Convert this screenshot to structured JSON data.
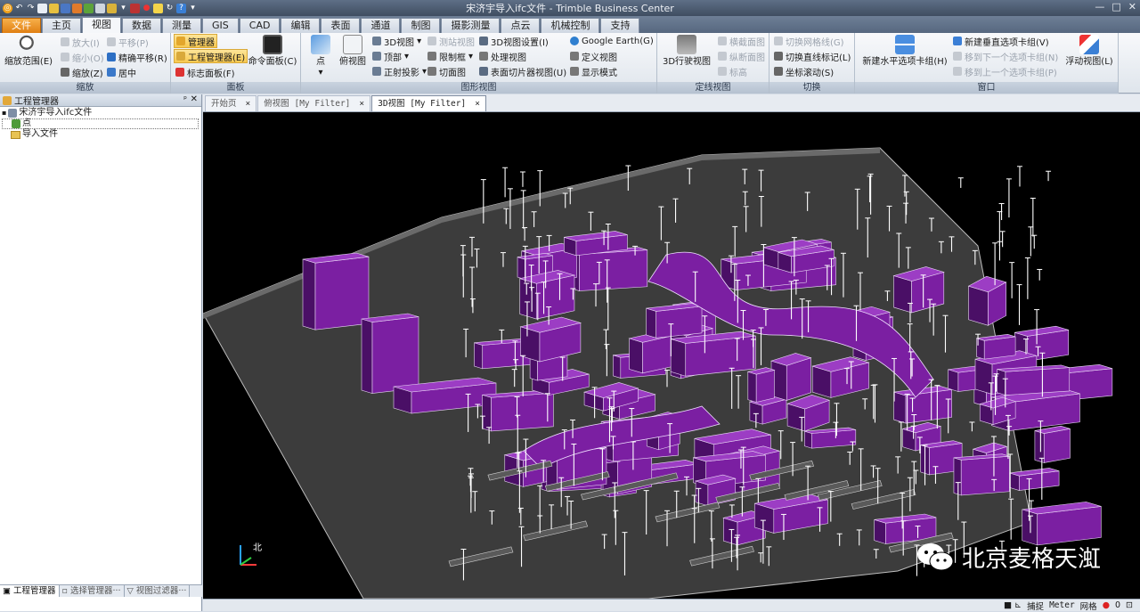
{
  "window": {
    "title": "宋济宇导入ifc文件 - Trimble Business Center"
  },
  "tabs": [
    "文件",
    "主页",
    "视图",
    "数据",
    "测量",
    "GIS",
    "CAD",
    "编辑",
    "表面",
    "通道",
    "制图",
    "摄影测量",
    "点云",
    "机械控制",
    "支持"
  ],
  "active_tab": "视图",
  "ribbon": {
    "zoom": {
      "label": "缩放",
      "zoom_extents": "缩放范围(E)",
      "zoom_in": "放大(I)",
      "zoom_out": "缩小(O)",
      "zoom": "缩放(Z)",
      "pan": "平移(P)",
      "precise_pan": "精确平移(R)",
      "center": "居中"
    },
    "panels": {
      "label": "面板",
      "manager": "管理器",
      "project_manager": "工程管理器(E)",
      "flag_panel": "标志面板(F)",
      "command_panel": "命令面板(C)"
    },
    "graphic": {
      "label": "图形视图",
      "point": "点",
      "plan_view": "俯视图",
      "view3d": "3D视图",
      "top": "顶部",
      "ortho": "正射投影",
      "survey_view": "测站视图",
      "limit_box": "限制框",
      "process_view": "处理视图",
      "section": "切面图",
      "settings3d": "3D视图设置(I)",
      "define_view": "定义视图",
      "surface_slicer": "表面切片器视图(U)",
      "google_earth": "Google Earth(G)",
      "display_mode": "显示模式"
    },
    "alignment": {
      "label": "定线视图",
      "drive3d": "3D行驶视图",
      "cross_section": "横截面图",
      "profile": "纵断面图",
      "plan": "标高"
    },
    "toggle": {
      "label": "切换",
      "toggle_grid": "切换网格线(G)",
      "toggle_line_marks": "切换直线标记(L)",
      "coord_scroll": "坐标滚动(S)"
    },
    "window": {
      "label": "窗口",
      "new_horiz": "新建水平选项卡组(H)",
      "new_vert": "新建垂直选项卡组(V)",
      "move_next": "移到下一个选项卡组(N)",
      "move_prev": "移到上一个选项卡组(P)",
      "float_view": "浮动视图(L)"
    }
  },
  "project_panel": {
    "title": "工程管理器",
    "root": "宋济宇导入ifc文件",
    "items": [
      "点",
      "导入文件"
    ],
    "tabs": [
      "工程管理器",
      "选择管理器···",
      "视图过滤器···"
    ]
  },
  "doc_tabs": [
    {
      "label": "开始页",
      "active": false
    },
    {
      "label": "俯视图 [My Filter]",
      "active": false
    },
    {
      "label": "3D视图 [My Filter]",
      "active": true
    }
  ],
  "tab_close": "×",
  "status": {
    "snap": "捕捉",
    "units": "Meter",
    "grid": "网格",
    "count": "0"
  },
  "watermark": "北京麦格天渱",
  "axis": {
    "north": "北"
  },
  "colors": {
    "duct": "#7b1fa2",
    "duct_dark": "#4a0f66",
    "duct_light": "#9c3dc4",
    "floor": "#3e3e3e",
    "pipe": "#ffffff"
  }
}
